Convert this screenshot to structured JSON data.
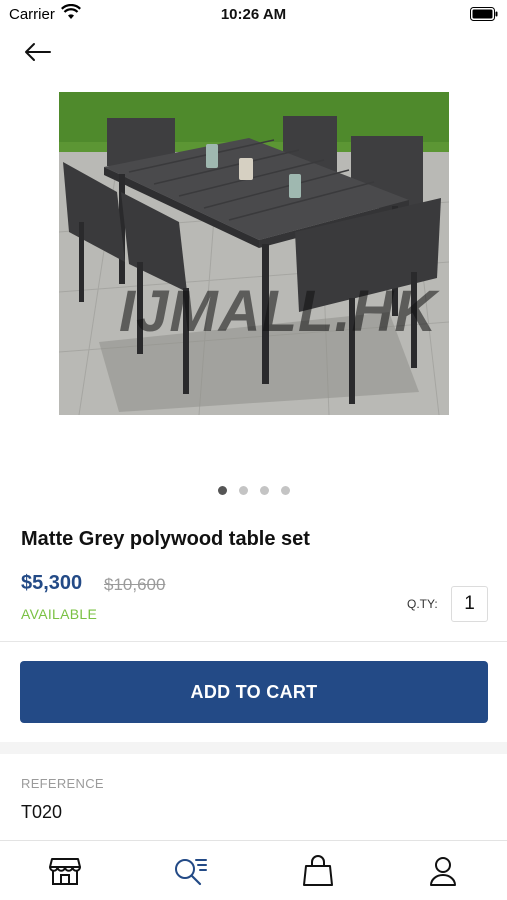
{
  "status_bar": {
    "carrier": "Carrier",
    "time": "10:26 AM"
  },
  "product": {
    "title": "Matte Grey polywood table set",
    "price": "$5,300",
    "old_price": "$10,600",
    "availability": "AVAILABLE",
    "qty_label": "Q.TY:",
    "qty_value": "1",
    "image_watermark": "IJMALL.HK",
    "image_count": 4,
    "active_image": 1
  },
  "actions": {
    "add_to_cart": "ADD TO CART"
  },
  "reference": {
    "label": "REFERENCE",
    "value": "T020"
  },
  "tab_bar": {
    "items": [
      {
        "icon": "store-icon",
        "active": false
      },
      {
        "icon": "search-list-icon",
        "active": true
      },
      {
        "icon": "shopping-bag-icon",
        "active": false
      },
      {
        "icon": "user-icon",
        "active": false
      }
    ]
  },
  "colors": {
    "primary": "#234a86",
    "available": "#7ac143",
    "muted": "#9b9b9b"
  }
}
